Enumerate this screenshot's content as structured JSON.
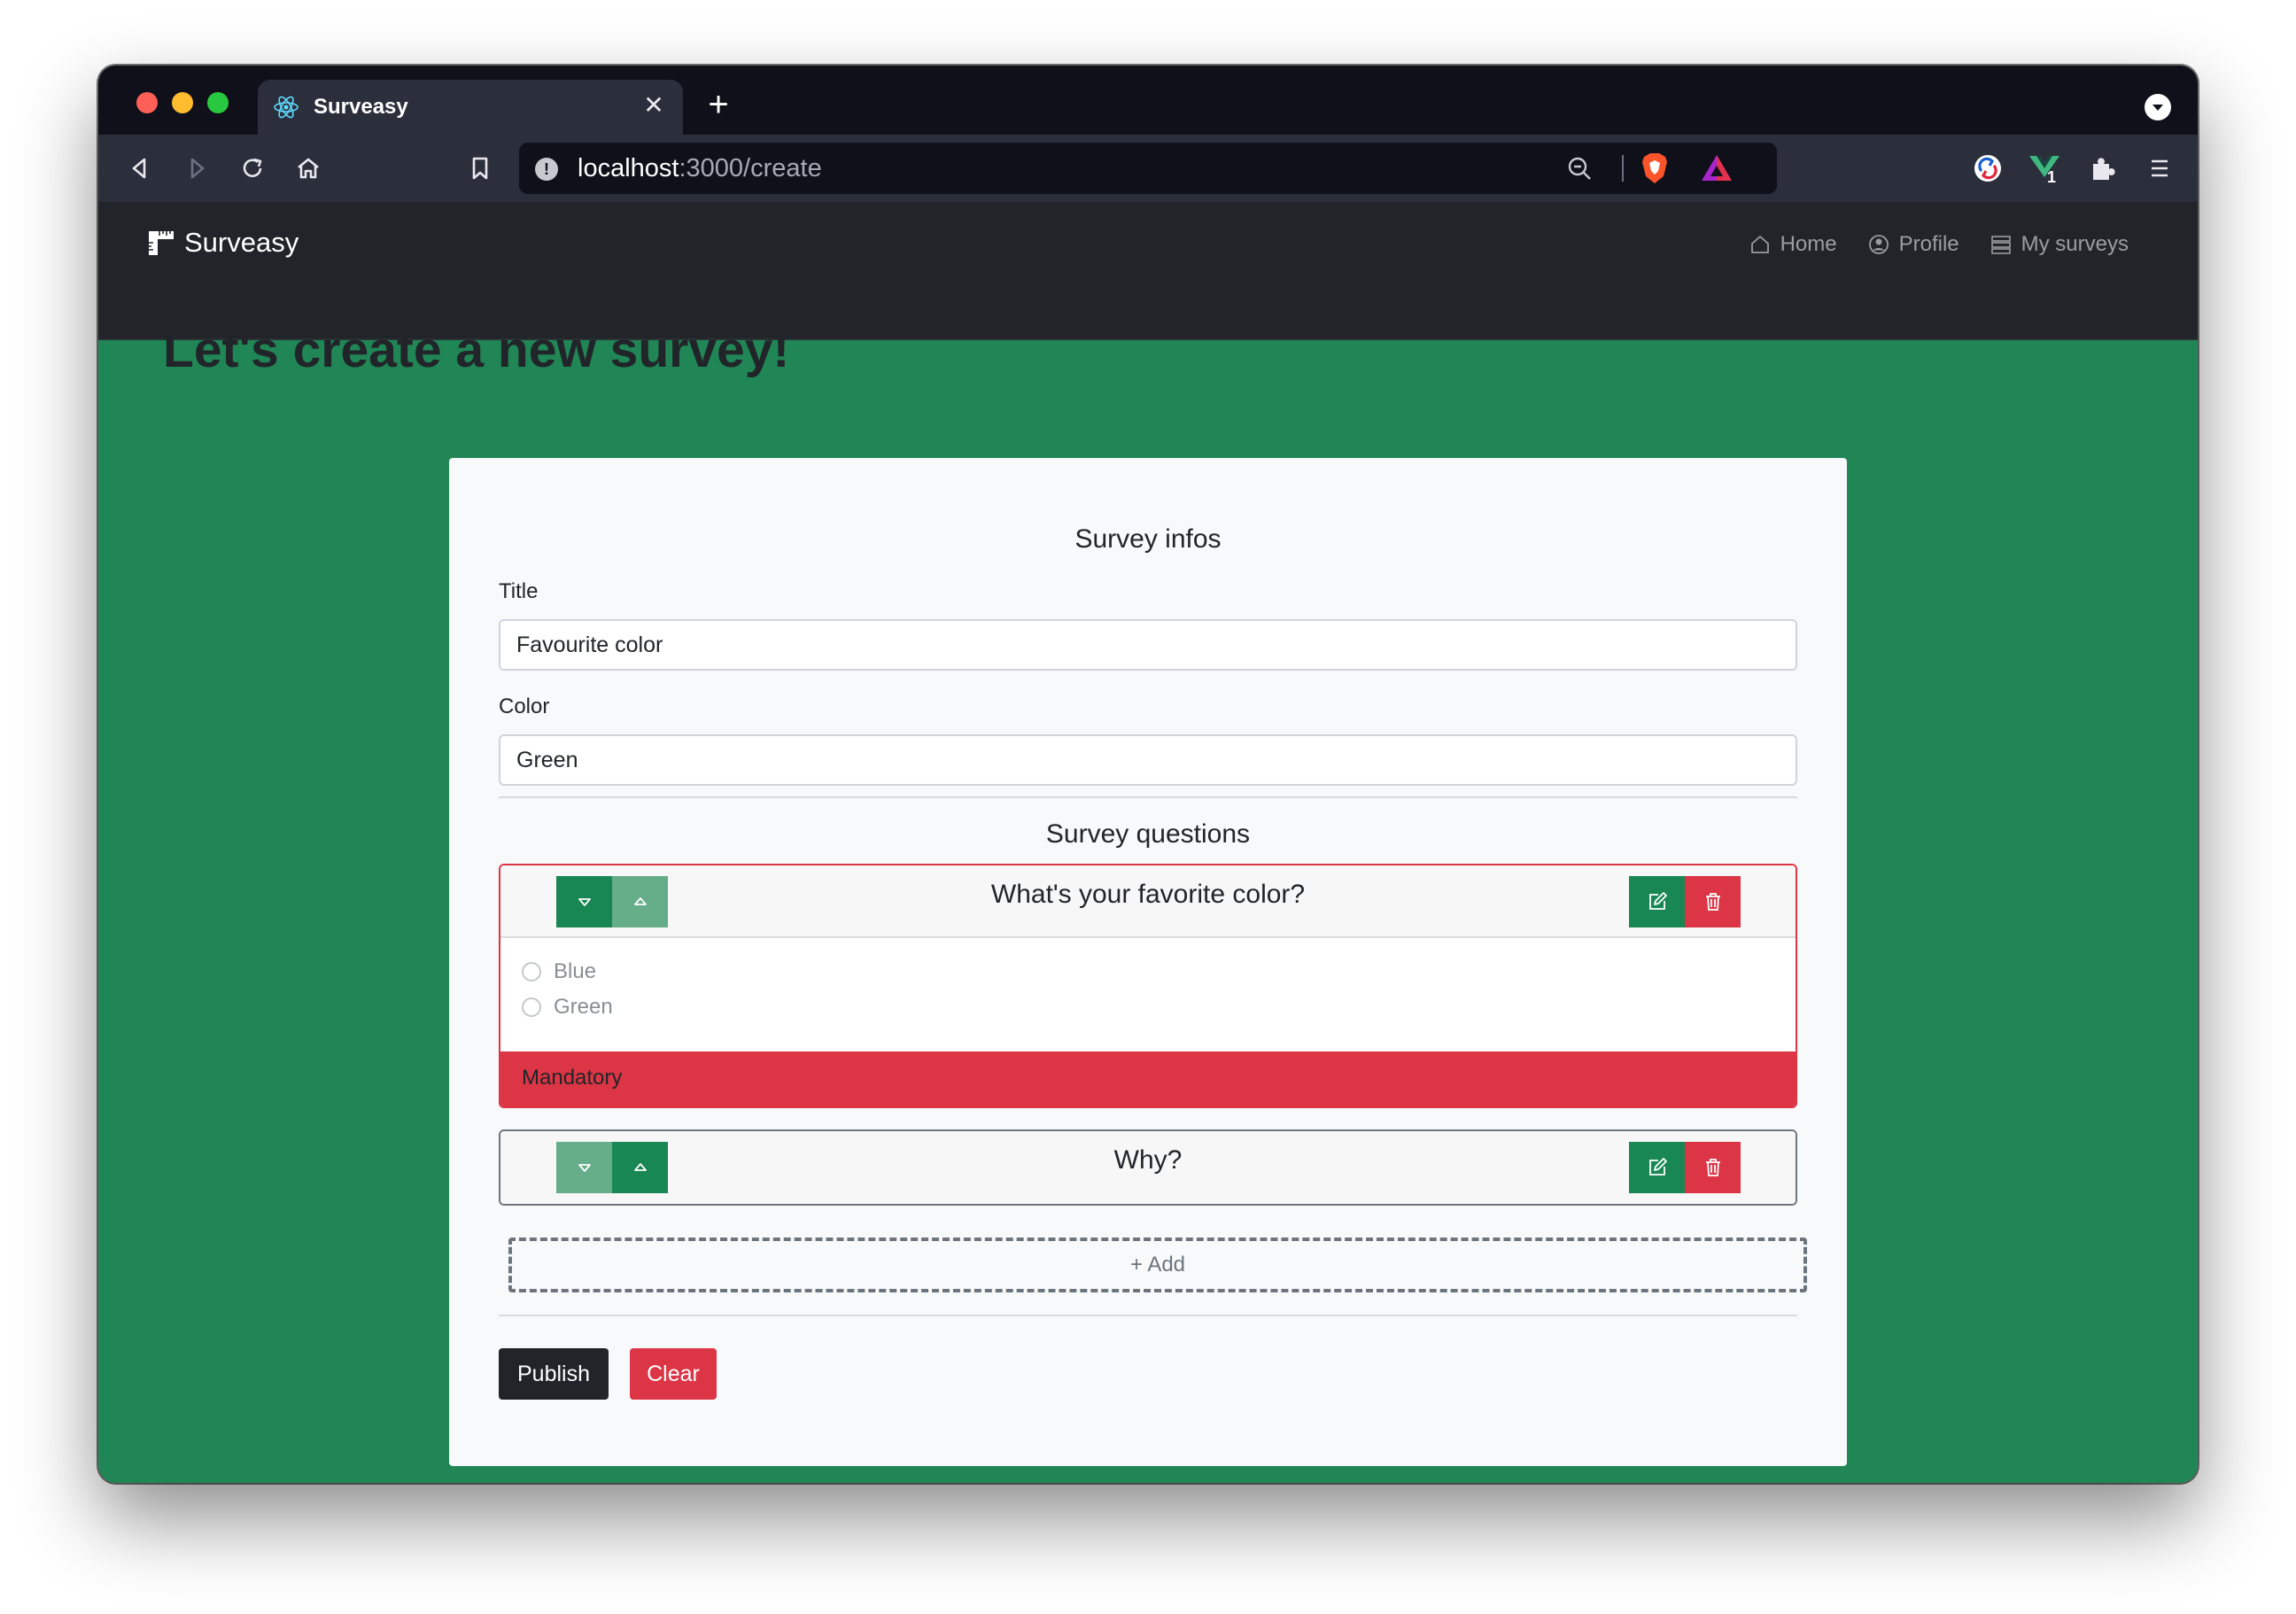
{
  "browser": {
    "tab_title": "Surveasy",
    "tab_close": "✕",
    "new_tab": "+",
    "url_host": "localhost",
    "url_path": ":3000/create",
    "addr_info": "!",
    "extension_badge": "1"
  },
  "navbar": {
    "brand": "Surveasy",
    "links": [
      {
        "label": "Home",
        "icon": "home-icon"
      },
      {
        "label": "Profile",
        "icon": "profile-icon"
      },
      {
        "label": "My surveys",
        "icon": "list-icon"
      }
    ]
  },
  "page": {
    "title": "Let's create a new survey!"
  },
  "survey_infos": {
    "heading": "Survey infos",
    "title_label": "Title",
    "title_value": "Favourite color",
    "color_label": "Color",
    "color_value": "Green"
  },
  "survey_questions": {
    "heading": "Survey questions",
    "questions": [
      {
        "title": "What's your favorite color?",
        "options": [
          "Blue",
          "Green"
        ],
        "footer": "Mandatory"
      },
      {
        "title": "Why?"
      }
    ],
    "add_label": "+ Add"
  },
  "actions": {
    "publish": "Publish",
    "clear": "Clear"
  },
  "colors": {
    "page_bg": "#218656",
    "navbar_bg": "#212529",
    "success": "#198754",
    "danger": "#dc3545",
    "dark": "#212529"
  }
}
